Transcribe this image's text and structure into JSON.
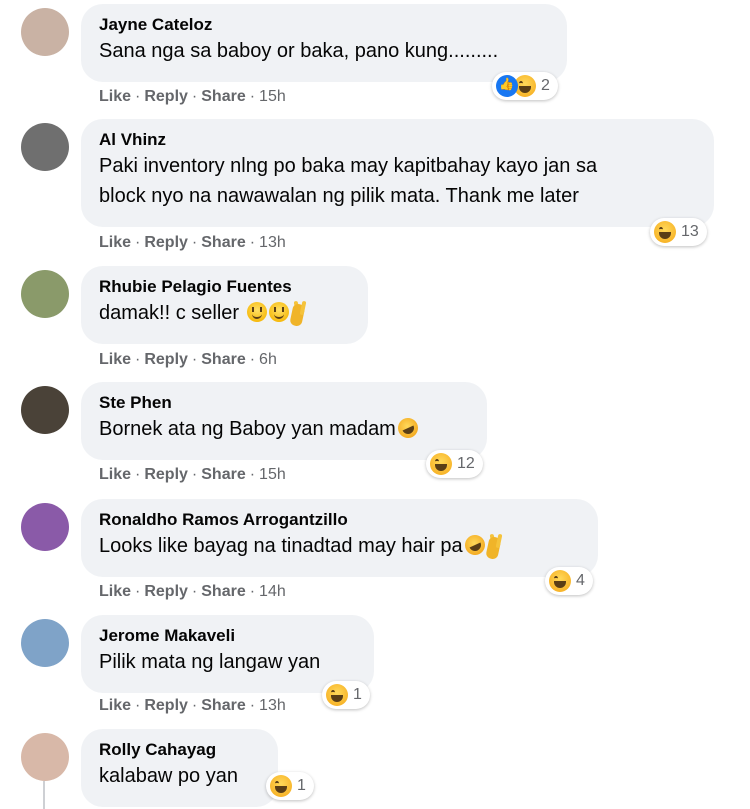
{
  "actions": {
    "like": "Like",
    "reply": "Reply",
    "share": "Share",
    "sep": "·"
  },
  "comments": [
    {
      "name": "Jayne Cateloz",
      "lines": "Sana nga sa baboy or baka, pano kung.........",
      "time": "15h",
      "reactions": [
        "like-icon",
        "haha-icon"
      ],
      "count": "2",
      "avatar_color": "#c9b2a4"
    },
    {
      "name": "Al Vhinz",
      "lines": "Paki inventory nlng po baka may kapitbahay kayo jan sa\nblock nyo na nawawalan ng pilik mata. Thank me later",
      "time": "13h",
      "reactions": [
        "haha-icon"
      ],
      "count": "13",
      "avatar_color": "#6f6f6f"
    },
    {
      "name": "Rhubie Pelagio Fuentes",
      "lines": "damak!! c seller",
      "time": "6h",
      "reactions": [],
      "count": "",
      "avatar_color": "#8a9a6a",
      "inline_emojis": [
        "smile-icon",
        "smile-icon",
        "victory-hand-icon"
      ]
    },
    {
      "name": "Ste Phen",
      "lines": "Bornek ata ng Baboy yan madam",
      "time": "15h",
      "reactions": [
        "haha-icon"
      ],
      "count": "12",
      "avatar_color": "#4a4238",
      "inline_emojis": [
        "rofl-icon"
      ]
    },
    {
      "name": "Ronaldho Ramos Arrogantzillo",
      "lines": "Looks like bayag na tinadtad may hair pa",
      "time": "14h",
      "reactions": [
        "haha-icon"
      ],
      "count": "4",
      "avatar_color": "#8a5aa8",
      "inline_emojis": [
        "rofl-icon",
        "victory-hand-icon"
      ]
    },
    {
      "name": "Jerome Makaveli",
      "lines": "Pilik mata ng langaw yan",
      "time": "13h",
      "reactions": [
        "haha-icon"
      ],
      "count": "1",
      "avatar_color": "#7fa3c8"
    },
    {
      "name": "Rolly Cahayag",
      "lines": "kalabaw po yan",
      "time": "",
      "reactions": [
        "haha-icon"
      ],
      "count": "1",
      "avatar_color": "#d8b8a8"
    }
  ]
}
